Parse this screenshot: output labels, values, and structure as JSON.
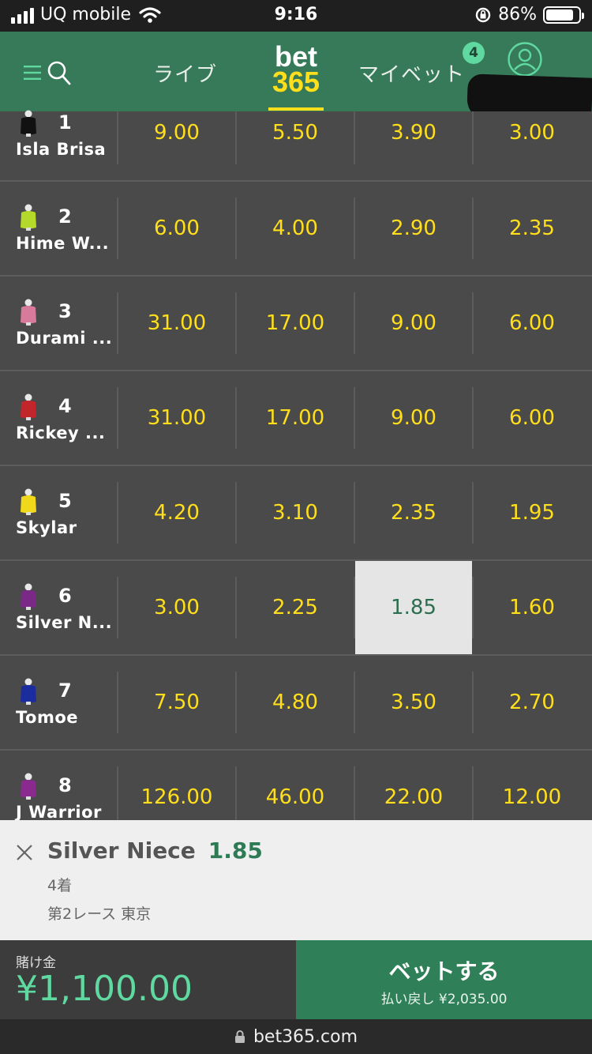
{
  "status_bar": {
    "carrier": "UQ mobile",
    "time": "9:16",
    "battery": "86%",
    "battery_level": 0.86
  },
  "nav": {
    "tab_live": "ライブ",
    "logo_top": "bet",
    "logo_bottom": "365",
    "tab_mybets": "マイベット",
    "mybets_badge": "4"
  },
  "runners": [
    {
      "num": "1",
      "name": "Isla Brisa",
      "silk_color": "#111111",
      "odds": [
        "9.00",
        "5.50",
        "3.90",
        "3.00"
      ]
    },
    {
      "num": "2",
      "name": "Hime W...",
      "silk_color": "#b5d92a",
      "odds": [
        "6.00",
        "4.00",
        "2.90",
        "2.35"
      ]
    },
    {
      "num": "3",
      "name": "Durami ...",
      "silk_color": "#d77a9c",
      "odds": [
        "31.00",
        "17.00",
        "9.00",
        "6.00"
      ]
    },
    {
      "num": "4",
      "name": "Rickey ...",
      "silk_color": "#c2262a",
      "odds": [
        "31.00",
        "17.00",
        "9.00",
        "6.00"
      ]
    },
    {
      "num": "5",
      "name": "Skylar",
      "silk_color": "#f0d81a",
      "odds": [
        "4.20",
        "3.10",
        "2.35",
        "1.95"
      ]
    },
    {
      "num": "6",
      "name": "Silver N...",
      "silk_color": "#7a2a86",
      "odds": [
        "3.00",
        "2.25",
        "1.85",
        "1.60"
      ]
    },
    {
      "num": "7",
      "name": "Tomoe",
      "silk_color": "#1b2c9e",
      "odds": [
        "7.50",
        "4.80",
        "3.50",
        "2.70"
      ]
    },
    {
      "num": "8",
      "name": "J Warrior",
      "silk_color": "#8a2a8e",
      "odds": [
        "126.00",
        "46.00",
        "22.00",
        "12.00"
      ]
    }
  ],
  "selected": {
    "runner_index": 5,
    "odds_index": 2
  },
  "bet_slip": {
    "selection": "Silver Niece",
    "odds": "1.85",
    "market": "4着",
    "race": "第2レース 東京"
  },
  "footer": {
    "stake_label": "賭け金",
    "stake_value": "¥1,100.00",
    "bet_button": "ベットする",
    "returns": "払い戻し ¥2,035.00",
    "url": "bet365.com"
  },
  "colors": {
    "header": "#367a5a",
    "odds_text": "#ffdf1b",
    "accent": "#5fd9a0",
    "bet_button": "#2f8058"
  }
}
